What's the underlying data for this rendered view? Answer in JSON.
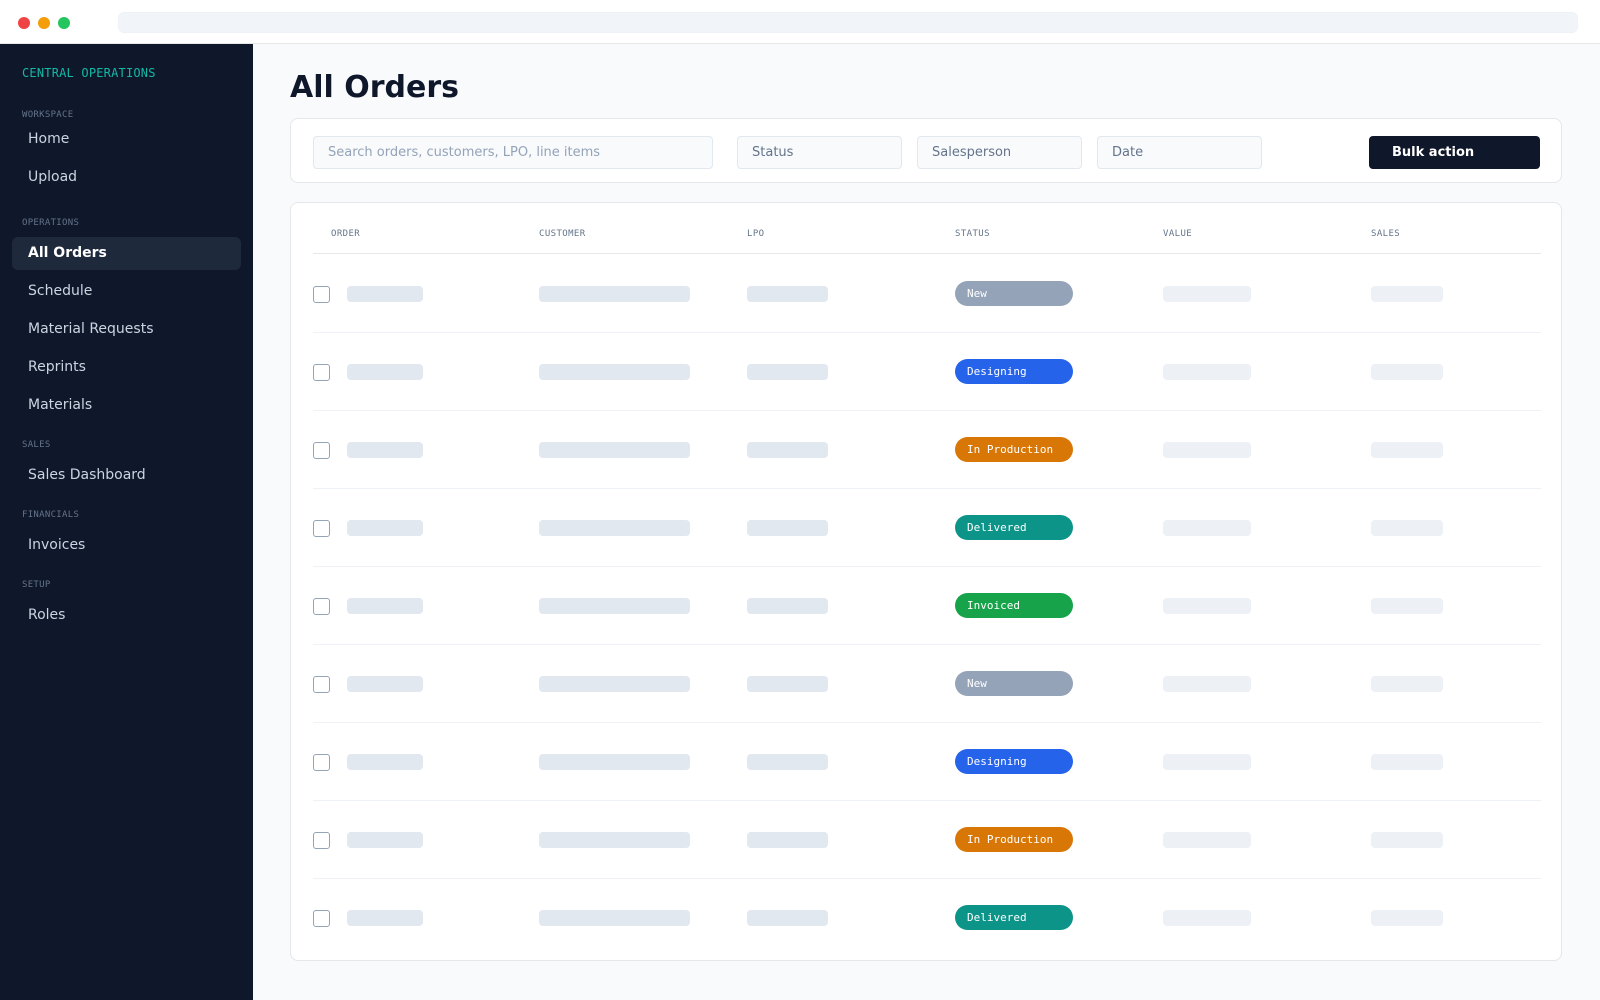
{
  "sidebar": {
    "brand": "CENTRAL OPERATIONS",
    "sections": [
      {
        "label": "WORKSPACE",
        "items": [
          "Home",
          "Upload"
        ]
      },
      {
        "label": "OPERATIONS",
        "items": [
          "All Orders",
          "Schedule",
          "Material Requests",
          "Reprints",
          "Materials"
        ]
      },
      {
        "label": "SALES",
        "items": [
          "Sales Dashboard"
        ]
      },
      {
        "label": "FINANCIALS",
        "items": [
          "Invoices"
        ]
      },
      {
        "label": "SETUP",
        "items": [
          "Roles"
        ]
      }
    ],
    "active_item": "All Orders"
  },
  "main": {
    "title": "All Orders",
    "filters": {
      "search_placeholder": "Search orders, customers, LPO, line items",
      "status": "Status",
      "salesperson": "Salesperson",
      "date": "Date",
      "bulk_action": "Bulk action"
    },
    "table": {
      "columns": [
        "ORDER",
        "CUSTOMER",
        "LPO",
        "STATUS",
        "VALUE",
        "SALES"
      ],
      "rows": [
        {
          "status": "New",
          "status_color": "#94a3b8"
        },
        {
          "status": "Designing",
          "status_color": "#2563eb"
        },
        {
          "status": "In Production",
          "status_color": "#d97706"
        },
        {
          "status": "Delivered",
          "status_color": "#0d9488"
        },
        {
          "status": "Invoiced",
          "status_color": "#16a34a"
        },
        {
          "status": "New",
          "status_color": "#94a3b8"
        },
        {
          "status": "Designing",
          "status_color": "#2563eb"
        },
        {
          "status": "In Production",
          "status_color": "#d97706"
        },
        {
          "status": "Delivered",
          "status_color": "#0d9488"
        }
      ]
    }
  },
  "colors": {
    "sidebar_bg": "#0f172a",
    "accent": "#14b8a6",
    "primary_button": "#0f172a"
  }
}
